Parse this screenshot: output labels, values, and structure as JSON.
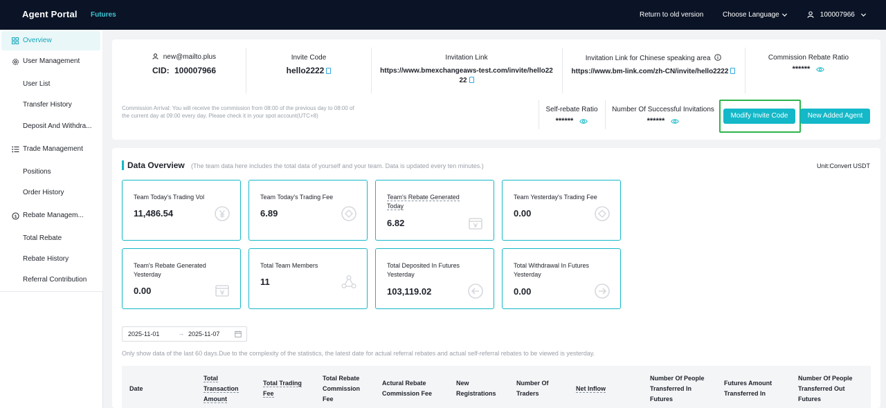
{
  "topbar": {
    "brand": "Agent Portal",
    "tab": "Futures",
    "return_link": "Return to old version",
    "language": "Choose Language",
    "account_id": "100007966"
  },
  "sidebar": {
    "items": [
      {
        "label": "Overview",
        "icon": "grid-icon"
      },
      {
        "label": "User Management",
        "icon": "gear-icon"
      },
      {
        "label": "User List"
      },
      {
        "label": "Transfer History"
      },
      {
        "label": "Deposit And Withdra..."
      },
      {
        "label": "Trade Management",
        "icon": "list-icon"
      },
      {
        "label": "Positions"
      },
      {
        "label": "Order History"
      },
      {
        "label": "Rebate Managem...",
        "icon": "dollar-icon"
      },
      {
        "label": "Total Rebate"
      },
      {
        "label": "Rebate History"
      },
      {
        "label": "Referral Contribution"
      }
    ]
  },
  "info": {
    "email": "new@mailto.plus",
    "cid_label": "CID:",
    "cid": "100007966",
    "invite_code_label": "Invite Code",
    "invite_code": "hello2222",
    "invitation_link_label": "Invitation Link",
    "invitation_link_line1": "https://www.bmexchangeaws-test.com/invite/hello22",
    "invitation_link_line2": "22",
    "cn_link_label": "Invitation Link for Chinese speaking area",
    "cn_link": "https://www.bm-link.com/zh-CN/invite/hello2222",
    "commission_label": "Commission Rebate Ratio",
    "commission_value": "******",
    "note": "Commission Arrival: You will receive the commission from 08:00 of the previous day to 08:00 of the current day at 09:00 every day. Please check it in your spot account(UTC+8)",
    "self_rebate_label": "Self-rebate Ratio",
    "self_rebate_value": "******",
    "invitations_label": "Number Of Successful Invitations",
    "invitations_value": "******",
    "modify_button": "Modify Invite Code",
    "new_agent_button": "New Added Agent"
  },
  "overview": {
    "title": "Data Overview",
    "note": "(The team data here includes the total data of yourself and your team. Data is updated every ten minutes.)",
    "unit": "Unit:Convert USDT",
    "cards": [
      {
        "label": "Team Today's Trading Vol",
        "value": "11,486.54",
        "icon": "yen-coin-icon"
      },
      {
        "label": "Team Today's Trading Fee",
        "value": "6.89",
        "icon": "diamond-coin-icon"
      },
      {
        "label": "Team's Rebate Generated Today",
        "value": "6.82",
        "icon": "wallet-icon"
      },
      {
        "label": "Team Yesterday's Trading Fee",
        "value": "0.00",
        "icon": "diamond-coin-icon"
      },
      {
        "label": "Team's Rebate Generated Yesterday",
        "value": "0.00",
        "icon": "wallet-icon"
      },
      {
        "label": "Total Team Members",
        "value": "11",
        "icon": "team-icon"
      },
      {
        "label": "Total Deposited In Futures Yesterday",
        "value": "103,119.02",
        "icon": "arrow-in-icon"
      },
      {
        "label": "Total Withdrawal In Futures Yesterday",
        "value": "0.00",
        "icon": "arrow-out-icon"
      }
    ],
    "date_start": "2025-11-01",
    "date_end": "2025-11-07",
    "date_note": "Only show data of the last 60 days.Due to the complexity of the statistics, the latest date for actual referral rebates and actual self-referral rebates to be viewed is yesterday.",
    "columns": [
      "Date",
      "Total Transaction Amount",
      "Total Trading Fee",
      "Total Rebate Commission Fee",
      "Actural Rebate Commission Fee",
      "New Registrations",
      "Number Of Traders",
      "Net Inflow",
      "Number Of People Transferred In Futures",
      "Futures Amount Transferred In",
      "Number Of People Transferred Out Futures"
    ]
  },
  "colors": {
    "accent": "#14b8c8",
    "topbar": "#0b1426",
    "highlight": "#2cb54a"
  }
}
